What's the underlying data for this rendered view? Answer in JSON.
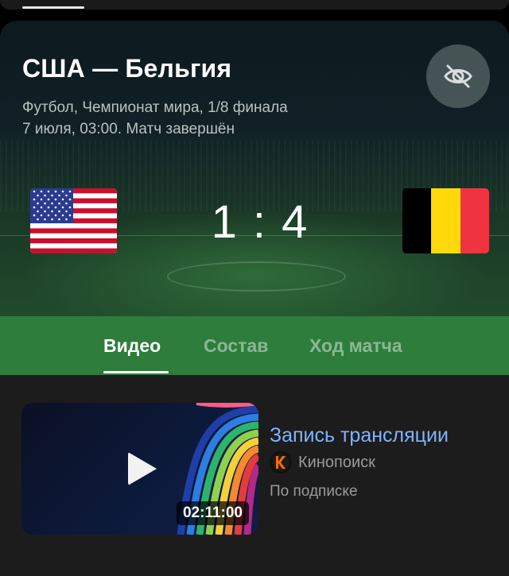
{
  "match": {
    "title": "США — Бельгия",
    "subtitle_line1": "Футбол, Чемпионат мира, 1/8 финала",
    "subtitle_line2": "7 июля, 03:00. Матч завершён",
    "score": "1 : 4",
    "home_flag": "usa-flag-icon",
    "away_flag": "belgium-flag-icon",
    "hide_icon": "eye-off-icon"
  },
  "tabs": [
    {
      "label": "Видео",
      "active": true
    },
    {
      "label": "Состав",
      "active": false
    },
    {
      "label": "Ход матча",
      "active": false
    }
  ],
  "video": {
    "title": "Запись трансляции",
    "provider": "Кинопоиск",
    "access": "По подписке",
    "duration": "02:11:00"
  },
  "colors": {
    "tabs_bg": "#2e7d3d",
    "link_blue": "#7fb3ff",
    "provider_orange": "#ff6a00"
  }
}
